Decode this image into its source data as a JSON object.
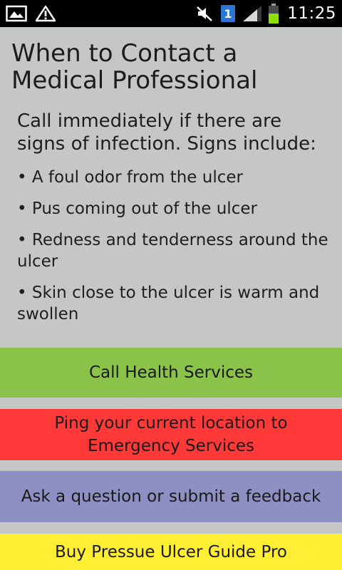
{
  "status_bar": {
    "time": "11:25",
    "notification_count": "1",
    "icons": [
      "image-icon",
      "warning-icon",
      "mute-icon",
      "notification-badge-icon",
      "signal-icon",
      "battery-icon"
    ],
    "battery_color": "#8ee000"
  },
  "page": {
    "title": "When to Contact a Medical Professional",
    "intro": "Call immediately if there are signs of infection. Signs include:",
    "bullets": [
      "• A foul odor from the ulcer",
      "• Pus coming out of the ulcer",
      "• Redness and tenderness around the ulcer",
      "• Skin close to the ulcer is warm and swollen"
    ]
  },
  "buttons": {
    "call": "Call Health Services",
    "ping": "Ping your current location to Emergency Services",
    "ask": "Ask a question or submit a feedback",
    "buy": "Buy Pressue Ulcer Guide  Pro"
  },
  "colors": {
    "background": "#c5c7c6",
    "call": "#8bc34a",
    "ping": "#ff3838",
    "ask": "#8e8fc3",
    "buy": "#ffee33"
  }
}
